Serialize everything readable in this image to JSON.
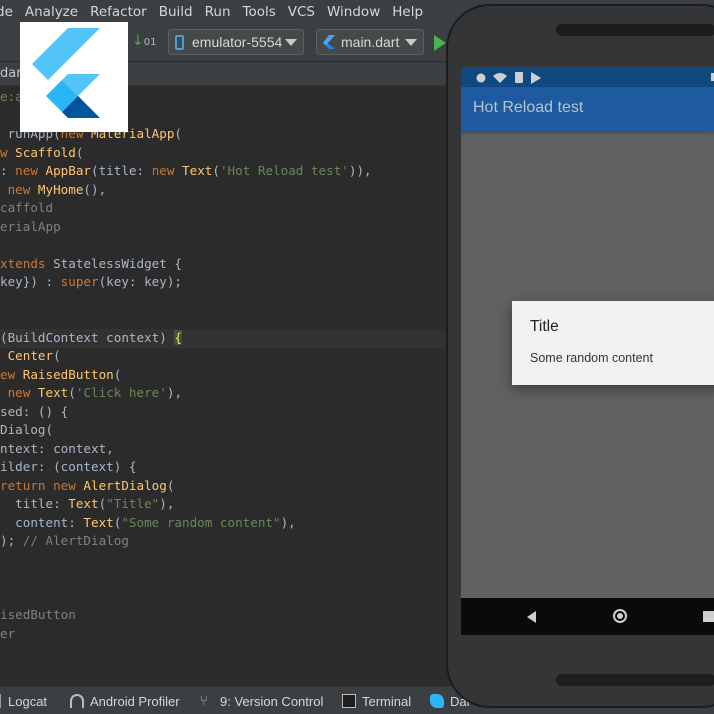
{
  "menubar": {
    "items": [
      "de",
      "Analyze",
      "Refactor",
      "Build",
      "Run",
      "Tools",
      "VCS",
      "Window",
      "Help"
    ]
  },
  "toolbar": {
    "device": "emulator-5554",
    "run_config": "main.dart"
  },
  "editor": {
    "tab_label": "dar",
    "lines": [
      {
        "segments": [
          {
            "t": "e:",
            "c": "str"
          },
          {
            "t": "al.dart';",
            "c": "str"
          }
        ]
      },
      {
        "segments": []
      },
      {
        "segments": [
          {
            "t": " runApp(",
            "c": "lbl"
          },
          {
            "t": "new ",
            "c": "kw"
          },
          {
            "t": "MaterialApp",
            "c": "cls"
          },
          {
            "t": "(",
            "c": "lbl"
          }
        ]
      },
      {
        "segments": [
          {
            "t": "w ",
            "c": "kw"
          },
          {
            "t": "Scaffold",
            "c": "cls"
          },
          {
            "t": "(",
            "c": "lbl"
          }
        ]
      },
      {
        "segments": [
          {
            "t": ": ",
            "c": "lbl"
          },
          {
            "t": "new ",
            "c": "kw"
          },
          {
            "t": "AppBar",
            "c": "cls"
          },
          {
            "t": "(title: ",
            "c": "lbl"
          },
          {
            "t": "new ",
            "c": "kw"
          },
          {
            "t": "Text",
            "c": "cls"
          },
          {
            "t": "(",
            "c": "lbl"
          },
          {
            "t": "'Hot Reload test'",
            "c": "str"
          },
          {
            "t": ")),",
            "c": "lbl"
          }
        ]
      },
      {
        "segments": [
          {
            "t": " new ",
            "c": "kw"
          },
          {
            "t": "MyHome",
            "c": "cls"
          },
          {
            "t": "(),",
            "c": "lbl"
          }
        ]
      },
      {
        "segments": [
          {
            "t": "caffold",
            "c": "cmt"
          }
        ]
      },
      {
        "segments": [
          {
            "t": "erialApp",
            "c": "cmt"
          }
        ]
      },
      {
        "segments": []
      },
      {
        "segments": [
          {
            "t": "xtends ",
            "c": "kw"
          },
          {
            "t": "StatelessWidget {",
            "c": "lbl"
          }
        ]
      },
      {
        "segments": [
          {
            "t": "key}) : ",
            "c": "lbl"
          },
          {
            "t": "super",
            "c": "kw"
          },
          {
            "t": "(key: key);",
            "c": "lbl"
          }
        ]
      },
      {
        "segments": []
      },
      {
        "segments": []
      },
      {
        "segments": [
          {
            "t": "(BuildContext context) ",
            "c": "lbl"
          },
          {
            "t": "{",
            "c": "hl"
          }
        ]
      },
      {
        "segments": [
          {
            "t": " Center",
            "c": "cls"
          },
          {
            "t": "(",
            "c": "lbl"
          }
        ]
      },
      {
        "segments": [
          {
            "t": "ew ",
            "c": "kw"
          },
          {
            "t": "RaisedButton",
            "c": "cls"
          },
          {
            "t": "(",
            "c": "lbl"
          }
        ]
      },
      {
        "segments": [
          {
            "t": " new ",
            "c": "kw"
          },
          {
            "t": "Text",
            "c": "cls"
          },
          {
            "t": "(",
            "c": "lbl"
          },
          {
            "t": "'Click here'",
            "c": "str"
          },
          {
            "t": "),",
            "c": "lbl"
          }
        ]
      },
      {
        "segments": [
          {
            "t": "sed: () {",
            "c": "lbl"
          }
        ]
      },
      {
        "segments": [
          {
            "t": "Dialog(",
            "c": "lbl"
          }
        ]
      },
      {
        "segments": [
          {
            "t": "ntext: context,",
            "c": "lbl"
          }
        ]
      },
      {
        "segments": [
          {
            "t": "ilder: (context) {",
            "c": "lbl"
          }
        ]
      },
      {
        "segments": [
          {
            "t": "return ",
            "c": "kw"
          },
          {
            "t": "new ",
            "c": "kw"
          },
          {
            "t": "AlertDialog",
            "c": "cls"
          },
          {
            "t": "(",
            "c": "lbl"
          }
        ]
      },
      {
        "segments": [
          {
            "t": "  title: ",
            "c": "lbl"
          },
          {
            "t": "Text",
            "c": "cls"
          },
          {
            "t": "(",
            "c": "lbl"
          },
          {
            "t": "\"Title\"",
            "c": "str"
          },
          {
            "t": "),",
            "c": "lbl"
          }
        ]
      },
      {
        "segments": [
          {
            "t": "  content: ",
            "c": "lbl"
          },
          {
            "t": "Text",
            "c": "cls"
          },
          {
            "t": "(",
            "c": "lbl"
          },
          {
            "t": "\"Some random content\"",
            "c": "str"
          },
          {
            "t": "),",
            "c": "lbl"
          }
        ]
      },
      {
        "segments": [
          {
            "t": "); ",
            "c": "lbl"
          },
          {
            "t": "// AlertDialog",
            "c": "cmt"
          }
        ]
      },
      {
        "segments": []
      },
      {
        "segments": []
      },
      {
        "segments": []
      },
      {
        "segments": [
          {
            "t": "isedButton",
            "c": "cmt"
          }
        ]
      },
      {
        "segments": [
          {
            "t": "er",
            "c": "cmt"
          }
        ]
      }
    ]
  },
  "bottombar": {
    "items": [
      {
        "label": "Logcat",
        "icon": "logcat-icon"
      },
      {
        "label": "Android Profiler",
        "icon": "profiler-icon"
      },
      {
        "label": "9: Version Control",
        "icon": "version-control-icon"
      },
      {
        "label": "Terminal",
        "icon": "terminal-icon"
      },
      {
        "label": "Dar",
        "icon": "dart-icon"
      }
    ]
  },
  "phone": {
    "app_title": "Hot Reload test",
    "dialog": {
      "title": "Title",
      "content": "Some random content"
    }
  },
  "colors": {
    "ide_bg": "#2b2b2b",
    "keyword": "#cc7832",
    "class": "#ffc66d",
    "string": "#6a8759",
    "comment": "#808080",
    "appbar": "#1e5aa0",
    "statusbar": "#104880"
  }
}
